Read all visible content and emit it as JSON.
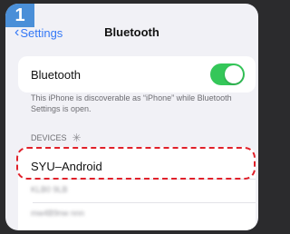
{
  "step_badge": "1",
  "nav": {
    "back_label": "Settings",
    "title": "Bluetooth"
  },
  "bluetooth": {
    "label": "Bluetooth",
    "toggle_on": true,
    "note": "This iPhone is discoverable as “iPhone” while Bluetooth Settings is open."
  },
  "devices": {
    "header": "DEVICES",
    "items": [
      {
        "name": "SYU–Android"
      },
      {
        "name": "KLB0 9LB"
      },
      {
        "name": "mw4B9nw nnn"
      }
    ]
  },
  "colors": {
    "accent": "#3478f6",
    "toggle_on": "#34c759",
    "highlight": "#e0202a",
    "badge": "#4a8fd8"
  }
}
